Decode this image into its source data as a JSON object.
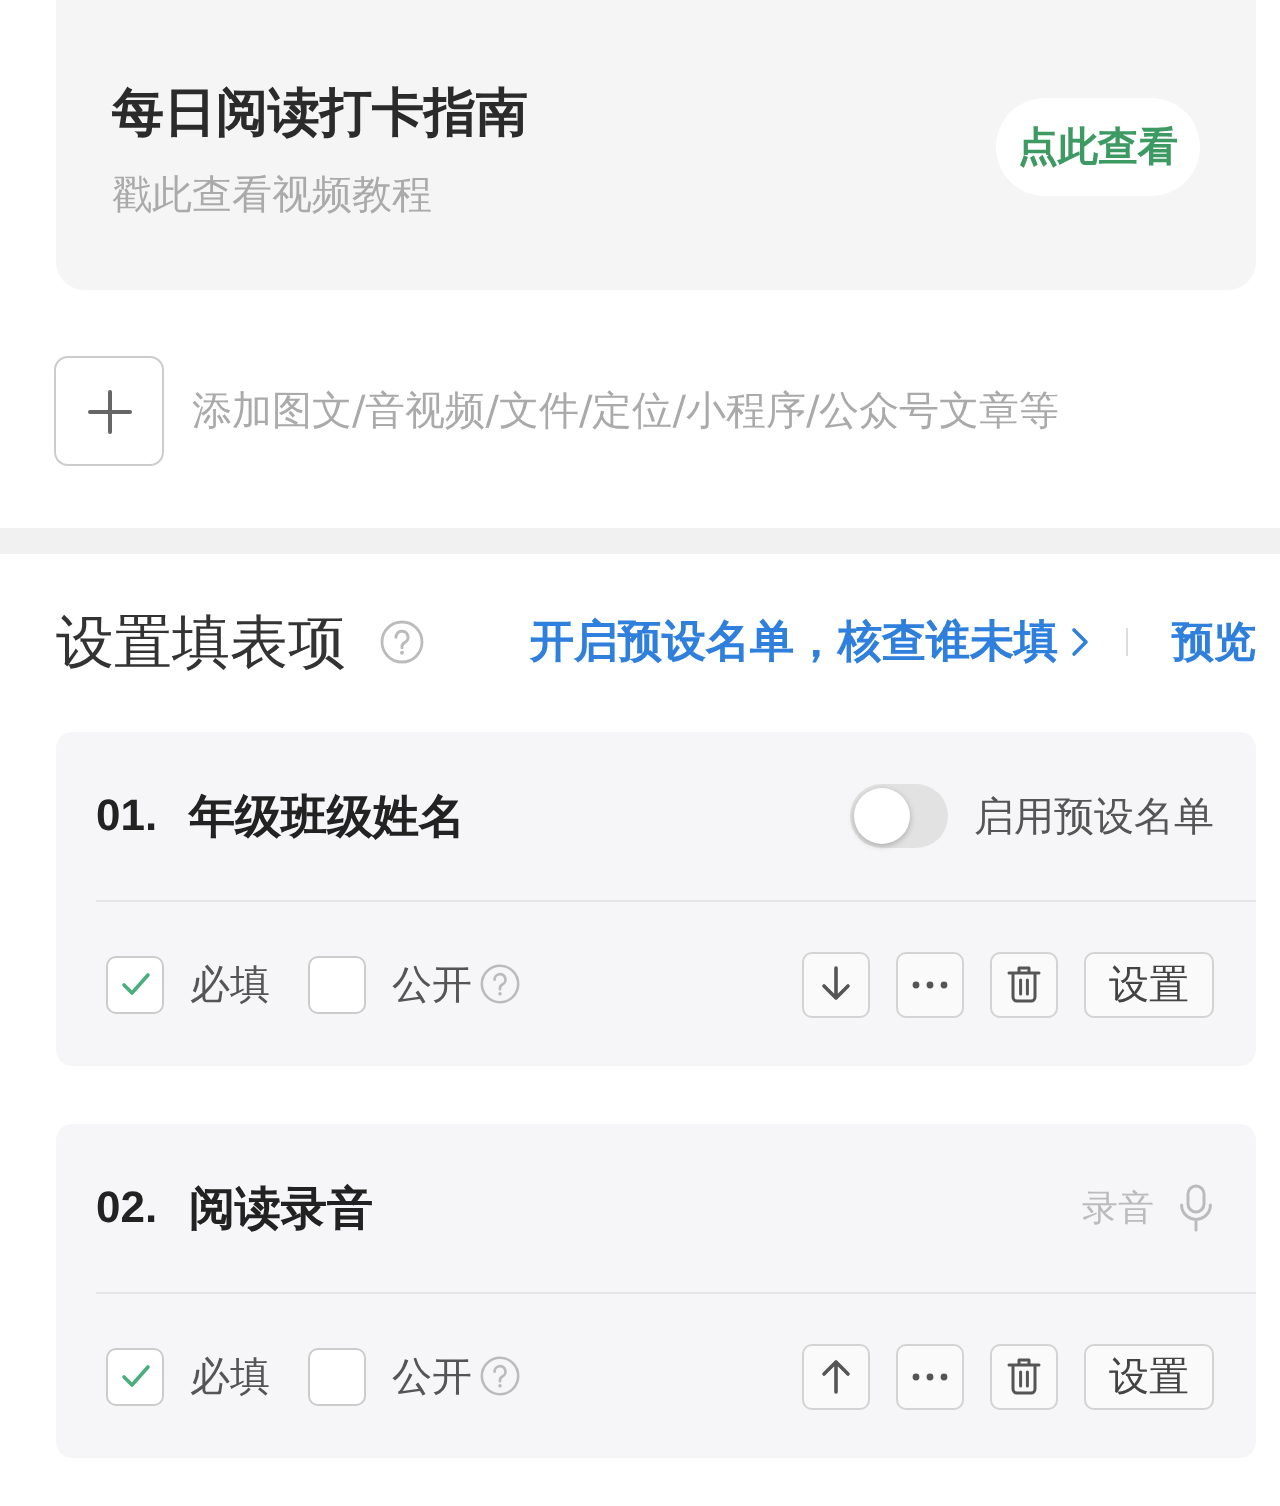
{
  "guide": {
    "title": "每日阅读打卡指南",
    "subtitle": "戳此查看视频教程",
    "button": "点此查看"
  },
  "attachment": {
    "hint": "添加图文/音视频/文件/定位/小程序/公众号文章等"
  },
  "section": {
    "title": "设置填表项",
    "link": "开启预设名单，核查谁未填",
    "preview": "预览"
  },
  "fields": [
    {
      "number": "01.",
      "title": "年级班级姓名",
      "kind": "text",
      "toggle": {
        "label": "启用预设名单",
        "on": false
      },
      "options": [
        {
          "label": "必填",
          "checked": true,
          "help": false
        },
        {
          "label": "公开",
          "checked": false,
          "help": true
        }
      ],
      "move_button": {
        "kind": "down"
      },
      "settings": "设置"
    },
    {
      "number": "02.",
      "title": "阅读录音",
      "kind": "audio",
      "type_label": "录音",
      "options": [
        {
          "label": "必填",
          "checked": true,
          "help": false
        },
        {
          "label": "公开",
          "checked": false,
          "help": true
        }
      ],
      "move_button": {
        "kind": "up"
      },
      "settings": "设置"
    }
  ]
}
